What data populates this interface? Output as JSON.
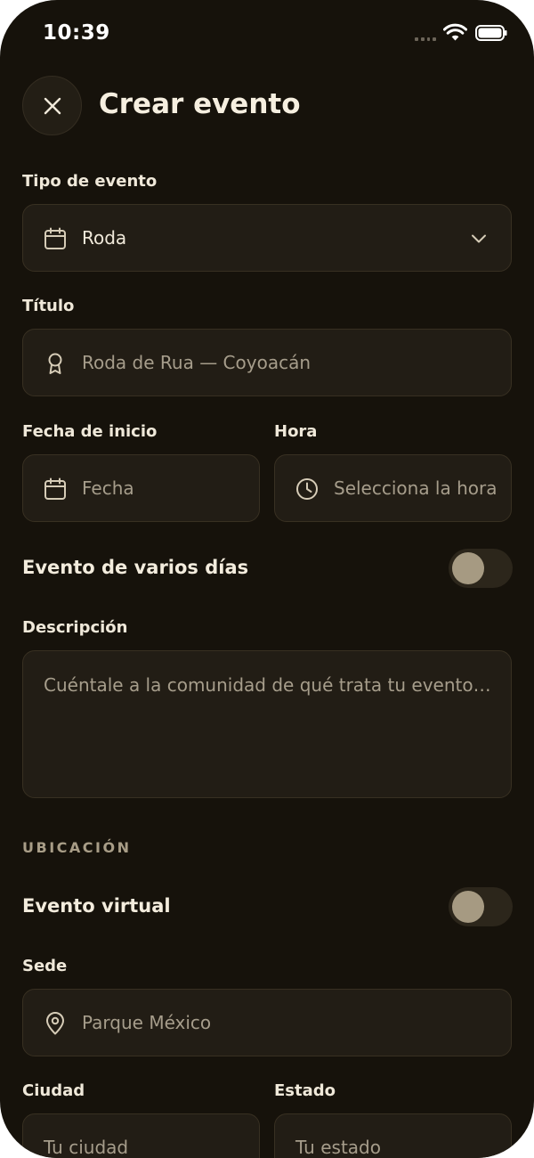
{
  "status_bar": {
    "time": "10:39"
  },
  "header": {
    "title": "Crear evento"
  },
  "event_type": {
    "label": "Tipo de evento",
    "value": "Roda"
  },
  "event_title": {
    "label": "Título",
    "placeholder": "Roda de Rua — Coyoacán"
  },
  "start_date": {
    "label": "Fecha de inicio",
    "placeholder": "Fecha"
  },
  "time_field": {
    "label": "Hora",
    "placeholder": "Selecciona la hora"
  },
  "multi_day": {
    "label": "Evento de varios días",
    "on": false
  },
  "description": {
    "label": "Descripción",
    "placeholder": "Cuéntale a la comunidad de qué trata tu evento…"
  },
  "location_section": {
    "title": "UBICACIÓN"
  },
  "virtual_event": {
    "label": "Evento virtual",
    "on": false
  },
  "venue": {
    "label": "Sede",
    "placeholder": "Parque México"
  },
  "city": {
    "label": "Ciudad",
    "placeholder": "Tu ciudad"
  },
  "state": {
    "label": "Estado",
    "placeholder": "Tu estado"
  },
  "colors": {
    "background": "#16120b",
    "field": "#221d15",
    "border": "#383022",
    "text": "#f3ecdd",
    "muted": "#a69d8b",
    "toggle_knob": "#a69a82"
  }
}
